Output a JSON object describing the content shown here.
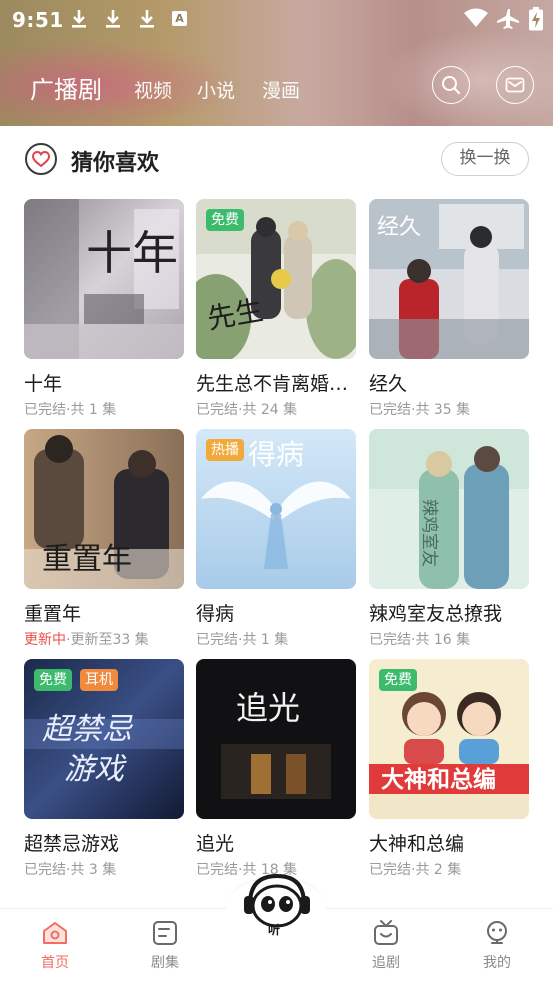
{
  "statusbar": {
    "time": "9:51",
    "a_icon_text": "A",
    "icons": [
      "download-icon",
      "download-icon",
      "download-icon",
      "a-notification-icon",
      "wifi-icon",
      "airplane-icon",
      "battery-charging-icon"
    ]
  },
  "nav": {
    "tabs": [
      {
        "label": "广播剧",
        "active": true
      },
      {
        "label": "视频",
        "active": false
      },
      {
        "label": "小说",
        "active": false
      },
      {
        "label": "漫画",
        "active": false
      }
    ],
    "icons": [
      "search-icon",
      "mail-icon"
    ]
  },
  "section": {
    "title": "猜你喜欢",
    "refresh_label": "换一换",
    "icon": "heart-icon"
  },
  "cards": [
    {
      "title": "十年",
      "status": "已完结",
      "sub": "·共 1 集",
      "badges": []
    },
    {
      "title": "先生总不肯离婚…",
      "status": "已完结",
      "sub": "·共 24 集",
      "badges": [
        "免费"
      ]
    },
    {
      "title": "经久",
      "status": "已完结",
      "sub": "·共 35 集",
      "badges": []
    },
    {
      "title": "重置年",
      "status": "更新中",
      "sub": "·更新至33 集",
      "badges": []
    },
    {
      "title": "得病",
      "status": "已完结",
      "sub": "·共 1 集",
      "badges": [
        "热播"
      ]
    },
    {
      "title": "辣鸡室友总撩我",
      "status": "已完结",
      "sub": "·共 16 集",
      "badges": []
    },
    {
      "title": "超禁忌游戏",
      "status": "已完结",
      "sub": "·共 3 集",
      "badges": [
        "免费",
        "耳机"
      ]
    },
    {
      "title": "追光",
      "status": "已完结",
      "sub": "·共 18 集",
      "badges": []
    },
    {
      "title": "大神和总编",
      "status": "已完结",
      "sub": "·共 2 集",
      "badges": [
        "免费"
      ]
    }
  ],
  "covers": {
    "c1": "十年",
    "c5": "得病",
    "c8": "追光",
    "c9": "大神和总编"
  },
  "bottom": {
    "tabs": [
      {
        "label": "首页",
        "icon": "home-icon",
        "active": true
      },
      {
        "label": "剧集",
        "icon": "drama-list-icon",
        "active": false
      },
      {
        "label": "追剧",
        "icon": "tv-icon",
        "active": false
      },
      {
        "label": "我的",
        "icon": "profile-icon",
        "active": false
      }
    ],
    "center_label": "听",
    "center_icon": "mascot-headphones-icon"
  },
  "colors": {
    "accent": "#f26d62",
    "free_badge": "#3dbb6c",
    "hot_badge": "#f2a93b",
    "update_text": "#e8504a"
  }
}
